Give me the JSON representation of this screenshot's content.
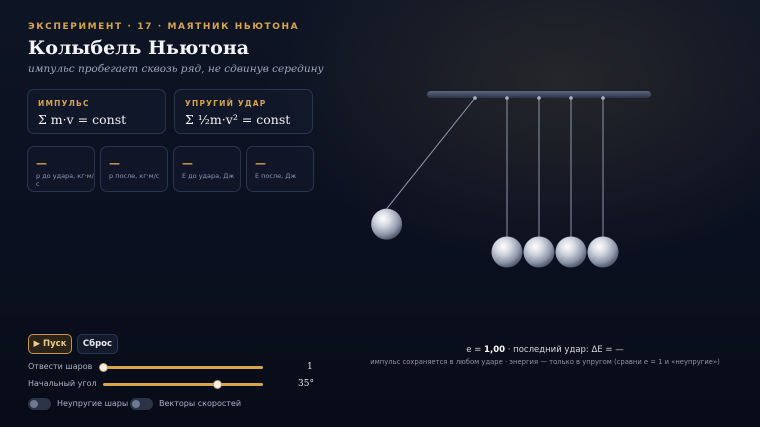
{
  "header": {
    "eyebrow": "ЭКСПЕРИМЕНТ · 17 · МАЯТНИК НЬЮТОНА",
    "title": "Колыбель Ньютона",
    "subtitle": "импульс пробегает сквозь ряд, не сдвинув середину"
  },
  "laws": [
    {
      "label": "ИМПУЛЬС",
      "formula": "Σ m·v = const"
    },
    {
      "label": "УПРУГИЙ УДАР",
      "formula": "Σ ½m·v² = const"
    }
  ],
  "stats": [
    {
      "value": "—",
      "label": "p до удара, кг·м/с"
    },
    {
      "value": "—",
      "label": "p после, кг·м/с"
    },
    {
      "value": "—",
      "label": "E до удара, Дж"
    },
    {
      "value": "—",
      "label": "E после, Дж"
    }
  ],
  "controls": {
    "play_label": "▶ Пуск",
    "reset_label": "Сброс",
    "balls": {
      "label": "Отвести шаров",
      "value_text": "1",
      "value": 1,
      "min": 1,
      "max": 4
    },
    "angle": {
      "label": "Начальный угол",
      "value_text": "35°",
      "value": 35,
      "min": 10,
      "max": 45
    },
    "toggles": [
      {
        "label": "Неупругие шары",
        "on": false
      },
      {
        "label": "Векторы скоростей",
        "on": false
      }
    ]
  },
  "readout": {
    "prefix": "e = ",
    "e_value": "1,00",
    "suffix": " · последний удар: ΔE = —",
    "note": "импульс сохраняется в любом ударе · энергия — только в упругом (сравни e = 1 и «неупругие»)"
  },
  "scene": {
    "ball_count": 5,
    "pulled_balls": 1,
    "angle_deg": 35,
    "colors": {
      "accent": "#d9a44e",
      "bar": "#3a4560",
      "ball": "#c9ced9"
    }
  }
}
